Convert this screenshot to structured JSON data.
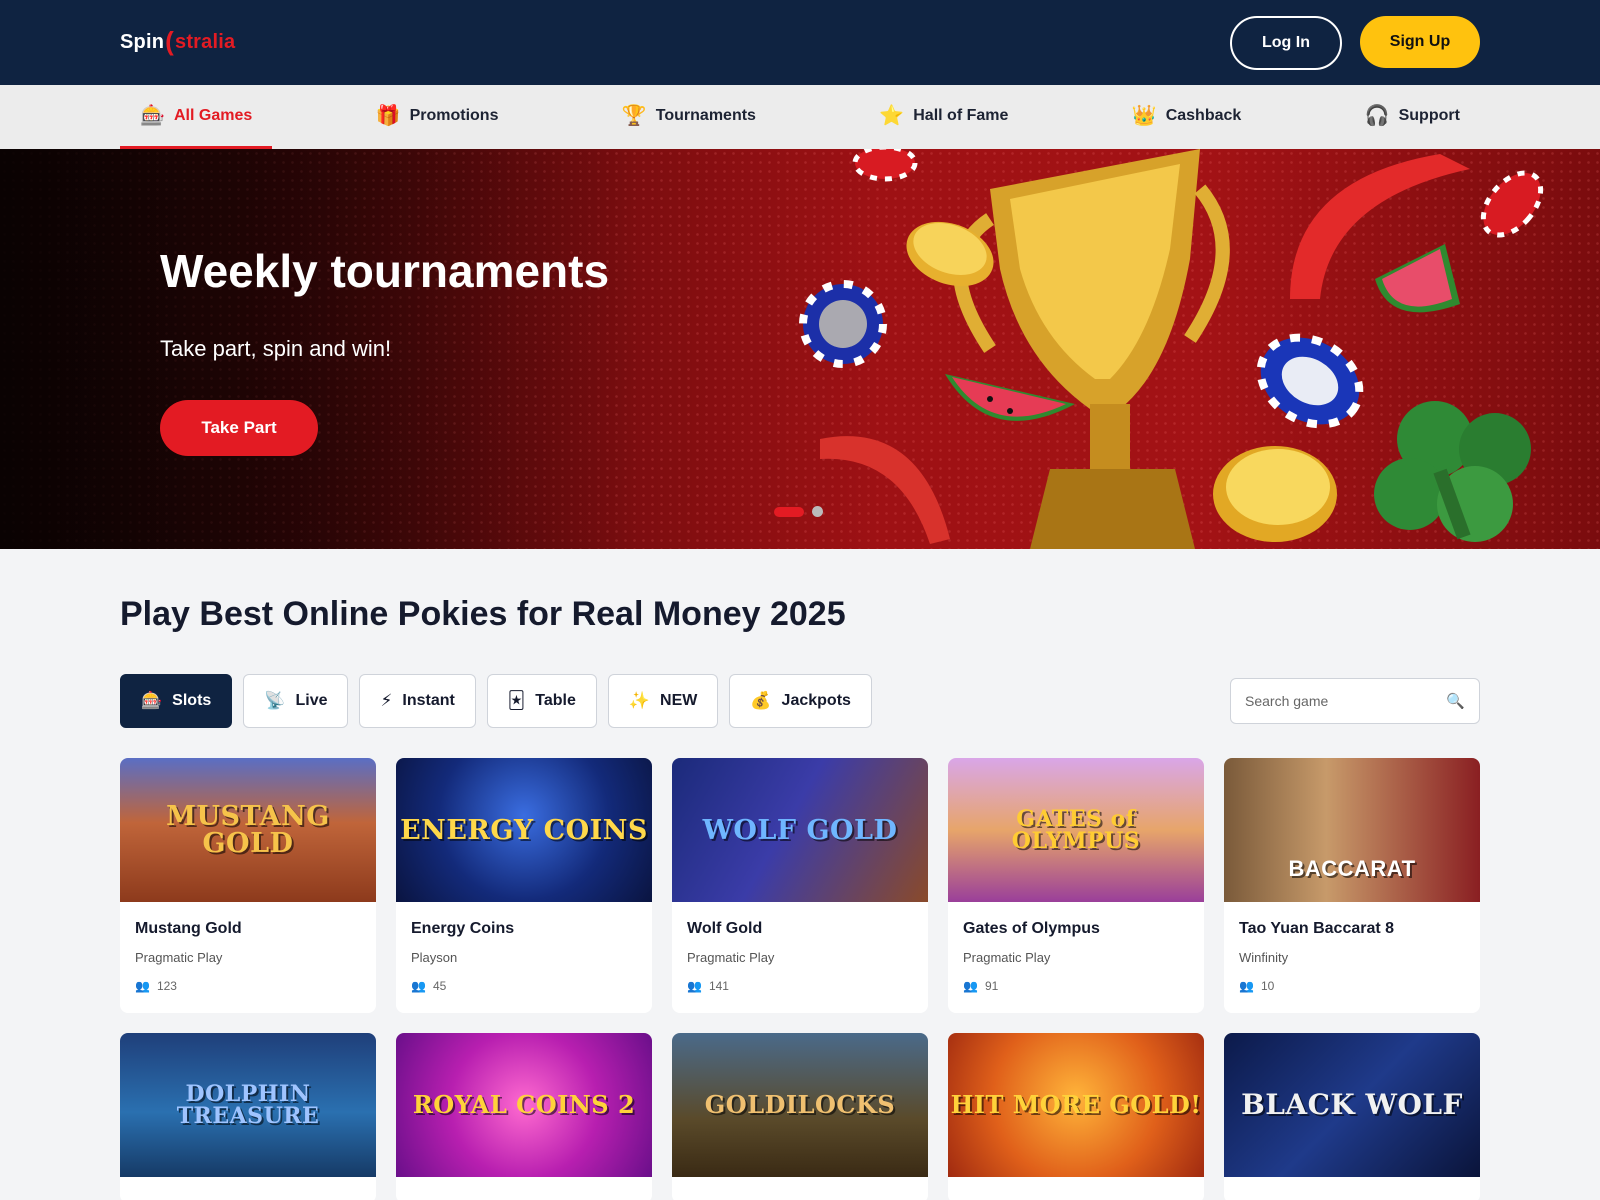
{
  "header": {
    "logo_part1": "Spin",
    "logo_sep": "(",
    "logo_part2": "stralia",
    "login_label": "Log In",
    "signup_label": "Sign Up"
  },
  "nav": {
    "items": [
      {
        "label": "All Games",
        "icon": "slot-machine-icon",
        "glyph": "🎰"
      },
      {
        "label": "Promotions",
        "icon": "gift-icon",
        "glyph": "🎁"
      },
      {
        "label": "Tournaments",
        "icon": "trophy-icon",
        "glyph": "🏆"
      },
      {
        "label": "Hall of Fame",
        "icon": "star-icon",
        "glyph": "⭐"
      },
      {
        "label": "Cashback",
        "icon": "crown-icon",
        "glyph": "👑"
      },
      {
        "label": "Support",
        "icon": "headphones-icon",
        "glyph": "🎧"
      }
    ]
  },
  "hero": {
    "title": "Weekly tournaments",
    "subtitle": "Take part, spin and win!",
    "cta": "Take Part"
  },
  "main": {
    "heading": "Play Best Online Pokies for Real Money 2025",
    "search_placeholder": "Search game",
    "filters": [
      {
        "label": "Slots",
        "icon": "slot-machine-icon",
        "glyph": "🎰"
      },
      {
        "label": "Live",
        "icon": "satellite-icon",
        "glyph": "📡"
      },
      {
        "label": "Instant",
        "icon": "lightning-icon",
        "glyph": "⚡"
      },
      {
        "label": "Table",
        "icon": "playing-card-icon",
        "glyph": "🃏"
      },
      {
        "label": "NEW",
        "icon": "sparkles-icon",
        "glyph": "✨"
      },
      {
        "label": "Jackpots",
        "icon": "money-bag-icon",
        "glyph": "💰"
      }
    ]
  },
  "games": [
    {
      "name": "Mustang Gold",
      "provider": "Pragmatic Play",
      "players": "123",
      "art": "MUSTANG GOLD",
      "art_color": "#f6c34a"
    },
    {
      "name": "Energy Coins",
      "provider": "Playson",
      "players": "45",
      "art": "ENERGY COINS",
      "art_color": "#ffd84a"
    },
    {
      "name": "Wolf Gold",
      "provider": "Pragmatic Play",
      "players": "141",
      "art": "WOLF GOLD",
      "art_color": "#6fb6ff"
    },
    {
      "name": "Gates of Olympus",
      "provider": "Pragmatic Play",
      "players": "91",
      "art": "GATES of OLYMPUS",
      "art_color": "#ffcc33"
    },
    {
      "name": "Tao Yuan Baccarat 8",
      "provider": "Winfinity",
      "players": "10",
      "art": "BACCARAT",
      "art_color": "#ffffff"
    }
  ],
  "games_row2": [
    {
      "art": "DOLPHIN TREASURE",
      "art_color": "#9fc4ff"
    },
    {
      "art": "ROYAL COINS 2",
      "art_color": "#ffd23a"
    },
    {
      "art": "GOLDILOCKS",
      "art_color": "#f0c070"
    },
    {
      "art": "HIT MORE GOLD!",
      "art_color": "#ffd23a"
    },
    {
      "art": "BLACK WOLF",
      "art_color": "#f1f1f1"
    }
  ]
}
